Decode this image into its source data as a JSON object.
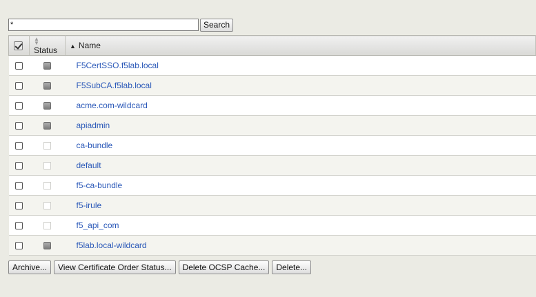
{
  "search": {
    "value": "*",
    "button_label": "Search"
  },
  "columns": {
    "status": "Status",
    "name": "Name"
  },
  "rows": [
    {
      "name": "F5CertSSO.f5lab.local",
      "status": "gray"
    },
    {
      "name": "F5SubCA.f5lab.local",
      "status": "gray"
    },
    {
      "name": "acme.com-wildcard",
      "status": "gray"
    },
    {
      "name": "apiadmin",
      "status": "gray"
    },
    {
      "name": "ca-bundle",
      "status": "blank"
    },
    {
      "name": "default",
      "status": "blank"
    },
    {
      "name": "f5-ca-bundle",
      "status": "blank"
    },
    {
      "name": "f5-irule",
      "status": "blank"
    },
    {
      "name": "f5_api_com",
      "status": "blank"
    },
    {
      "name": "f5lab.local-wildcard",
      "status": "gray"
    }
  ],
  "actions": {
    "archive": "Archive...",
    "view_order_status": "View Certificate Order Status...",
    "delete_ocsp": "Delete OCSP Cache...",
    "delete": "Delete..."
  },
  "colors": {
    "link": "#2a58b8",
    "background": "#ebebe4",
    "status_gray": "#8a8a8a"
  }
}
